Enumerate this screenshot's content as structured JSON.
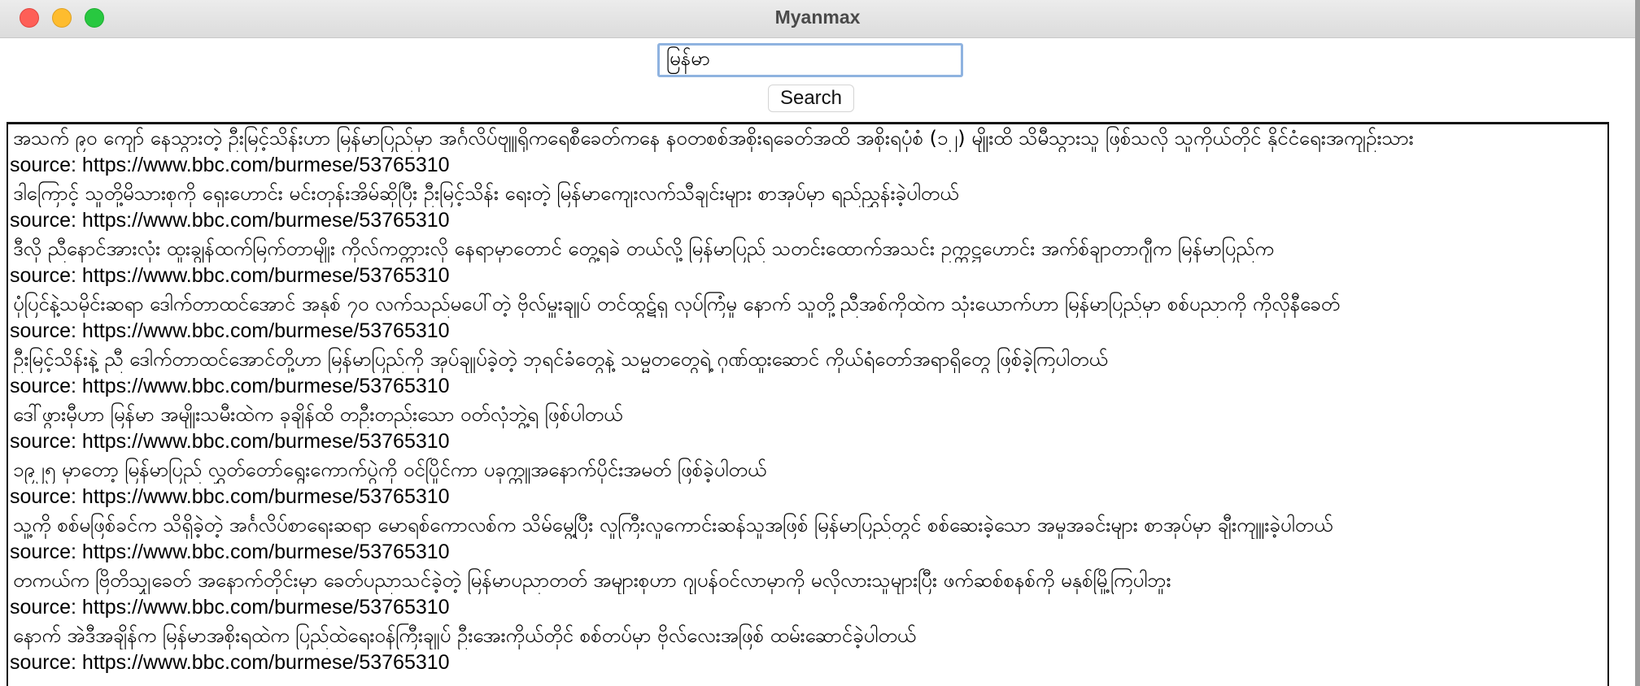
{
  "window": {
    "title": "Myanmax"
  },
  "search": {
    "value": "မြန်မာ",
    "placeholder": "",
    "button_label": "Search"
  },
  "results": [
    {
      "text": "အသက် ၉၀ ကျော် နေသွားတဲ့ ဦးမြင့်သိန်းဟာ မြန်မာပြည်မှာ အင်္ဂလိပ်ဗျူရိုကရေစီခေတ်ကနေ နဝတစစ်အစိုးရခေတ်အထိ အစိုးရပုံစံ (၁၂) မျိုးထိ သိမီသွားသူ ဖြစ်သလို သူကိုယ်တိုင် နိုင်ငံရေးအကျဉ်းသား",
      "source": "source: https://www.bbc.com/burmese/53765310"
    },
    {
      "text": "ဒါကြောင့် သူတို့မိသားစုကို ရှေးဟောင်း မင်းတုန်းအိမ်ဆိုပြီး ဦးမြင့်သိန်း ရေးတဲ့  မြန်မာကျေးလက်သီချင်းများ  စာအုပ်မှာ ရည်ညွှန်းခဲ့ပါတယ်",
      "source": "source: https://www.bbc.com/burmese/53765310"
    },
    {
      "text": "ဒီလို ညီနောင်အားလုံး ထူးချွန်ထက်မြက်တာမျိုး ကိုလ်ကတ္တားလို နေရာမှာတောင် တွေ့ရခဲ တယ်လို့ မြန်မာပြည် သတင်းထောက်အသင်း ဥက္ကဋ္ဌဟောင်း အက်စ်ချာတာဂျီက မြန်မာပြည်က",
      "source": "source: https://www.bbc.com/burmese/53765310"
    },
    {
      "text": "ပုံပြင်နဲ့သမိုင်းဆရာ ဒေါက်တာထင်အောင် အနှစ် ၇၀ လက်သည်မပေါ်တဲ့ ဗိုလ်မှူးချုပ် တင်ထွဋ်ရှ လုပ်ကြံမှု နောက် သူတို့ညီအစ်ကိုထဲက သုံးယောက်ဟာ မြန်မာပြည်မှာ စစ်ပညာကို ကိုလိုနီခေတ်",
      "source": "source: https://www.bbc.com/burmese/53765310"
    },
    {
      "text": "ဦးမြင့်သိန်းနဲ့ ညီ ဒေါက်တာထင်အောင်တို့ဟာ မြန်မာပြည်ကို အုပ်ချုပ်ခဲ့တဲ့ ဘုရင်ခံတွေနဲ့ သမ္မတတွေရဲ့ ဂုဏ်ထူးဆောင် ကိုယ်ရံတော်အရာရှိတွေ ဖြစ်ခဲ့ကြပါတယ်",
      "source": "source: https://www.bbc.com/burmese/53765310"
    },
    {
      "text": "ဒေါ်ဖွားမှီဟာ မြန်မာ အမျိုးသမီးထဲက ခုချိန်ထိ တဦးတည်းသော ဝတ်လုံဘွဲ့ရ ဖြစ်ပါတယ်",
      "source": "source: https://www.bbc.com/burmese/53765310"
    },
    {
      "text": "၁၉၂၅ မှာတော့ မြန်မာပြည် လွှတ်တော်ရွေးကောက်ပွဲကို  ဝင်ပြိုင်ကာ ပခုက္ကူအနောက်ပိုင်းအမတ် ဖြစ်ခဲ့ပါတယ်",
      "source": "source: https://www.bbc.com/burmese/53765310"
    },
    {
      "text": "သူ့ကို စစ်မဖြစ်ခင်က သိရှိခဲ့တဲ့ အင်္ဂလိပ်စာရေးဆရာ မောရစ်ကောလစ်က သိမ်မွေ့ပြီး လူကြီးလူကောင်းဆန်သူအဖြစ်  မြန်မာပြည်တွင် စစ်ဆေးခဲ့သော အမှုအခင်းများ  စာအုပ်မှာ ချီးကျူးခဲ့ပါတယ်",
      "source": "source: https://www.bbc.com/burmese/53765310"
    },
    {
      "text": "တကယ်က ဗြိတိသျှခေတ် အနောက်တိုင်းမှာ ခေတ်ပညာသင်ခဲ့တဲ့ မြန်မာပညာတတ် အများစုဟာ ဂျပန်ဝင်လာမှာကို မလိုလားသူများပြီး ဖက်ဆစ်စနစ်ကို မနှစ်မြို့ကြပါဘူး",
      "source": "source: https://www.bbc.com/burmese/53765310"
    },
    {
      "text": "နောက် အဲဒီအချိန်က မြန်မာအစိုးရထဲက ပြည်ထဲရေးဝန်ကြီးချုပ် ဦးအေးကိုယ်တိုင် စစ်တပ်မှာ ဗိုလ်လေးအဖြစ် ထမ်းဆောင်ခဲ့ပါတယ်",
      "source": "source: https://www.bbc.com/burmese/53765310"
    }
  ]
}
